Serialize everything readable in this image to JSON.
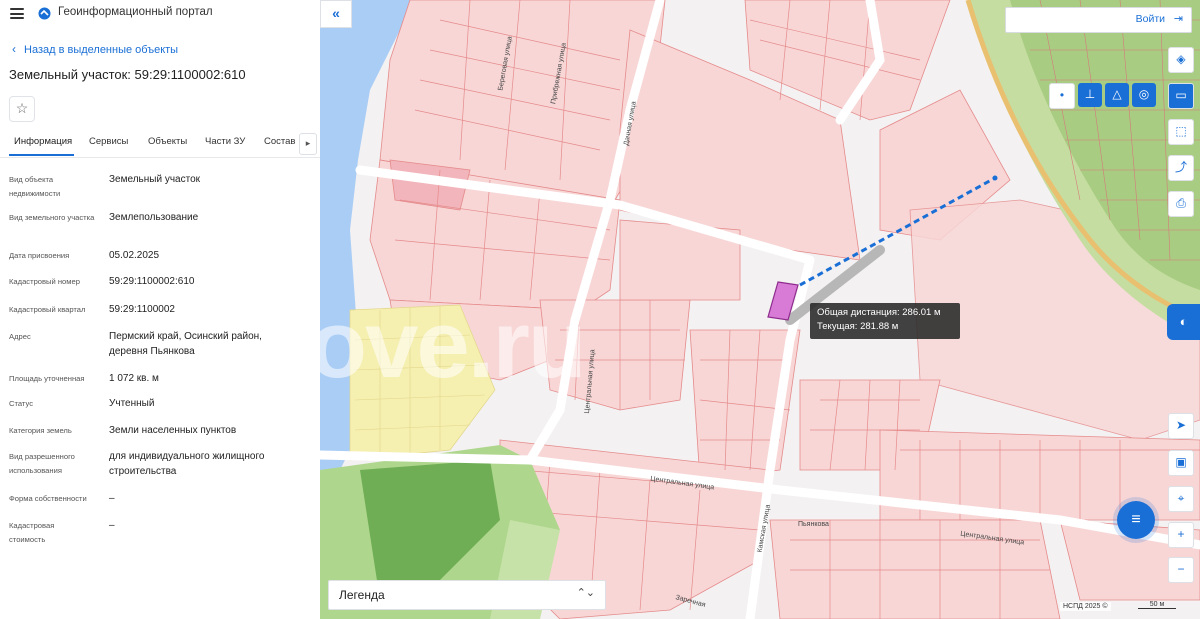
{
  "app": {
    "title": "Геоинформационный портал"
  },
  "panel": {
    "back_link": "Назад в выделенные объекты",
    "object_title": "Земельный участок: 59:29:1100002:610",
    "tabs": [
      "Информация",
      "Сервисы",
      "Объекты",
      "Части ЗУ",
      "Состав"
    ],
    "active_tab": "Информация",
    "rows": [
      {
        "label": "Вид объекта недвижимости",
        "value": "Земельный участок"
      },
      {
        "label": "Вид земельного участка",
        "value": "Землепользование"
      },
      {
        "label": "Дата присвоения",
        "value": "05.02.2025"
      },
      {
        "label": "Кадастровый номер",
        "value": "59:29:1100002:610"
      },
      {
        "label": "Кадастровый квартал",
        "value": "59:29:1100002"
      },
      {
        "label": "Адрес",
        "value": "Пермский край, Осинский район, деревня Пьянкова"
      },
      {
        "label": "Площадь уточненная",
        "value": "1 072 кв. м"
      },
      {
        "label": "Статус",
        "value": "Учтенный"
      },
      {
        "label": "Категория земель",
        "value": "Земли населенных пунктов"
      },
      {
        "label": "Вид разрешенного использования",
        "value": "для индивидуального жилищного строительства"
      },
      {
        "label": "Форма собственности",
        "value": "–"
      },
      {
        "label": "Кадастровая стоимость",
        "value": "–"
      }
    ]
  },
  "map": {
    "login_label": "Войти",
    "tooltip": {
      "total": "Общая дистанция: 286.01 м",
      "current": "Текущая: 281.88 м"
    },
    "legend_label": "Легенда",
    "copyright": "НСПД 2025 ©",
    "scale": "50 м",
    "watermark": "move.ru",
    "streets": {
      "dachnaya": "Дачная улица",
      "tsentralnaya_1": "Центральная улица",
      "tsentralnaya_2": "Центральная улица",
      "tsentralnaya_3": "Центральная улица",
      "kamskaya": "Камская улица",
      "beregovaya": "Береговая улица",
      "pribrezhnaya": "Прибрежная улица",
      "zarechnaya": "Заречная",
      "pyankova": "Пьянкова"
    },
    "colors": {
      "accent": "#1a6fd6",
      "parcel_fill": "#f8d6d6",
      "parcel_stroke": "#e07e7e",
      "water": "#aacdf5",
      "selected_parcel": "#d77bd6",
      "forest": "#7fb763",
      "meadow": "#f5efb0"
    }
  }
}
